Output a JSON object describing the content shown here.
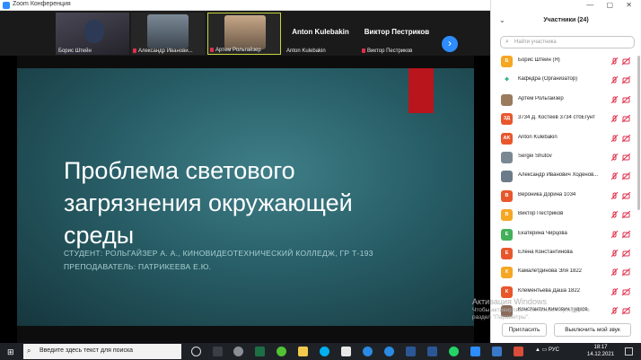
{
  "window_title": "Zoom Конференция",
  "gallery": {
    "tiles": [
      {
        "name": "Борис Штейн",
        "muted": false,
        "kind": "video",
        "color": "#3a3a44"
      },
      {
        "name": "Александр Иванови...",
        "muted": true,
        "kind": "video",
        "color": "#4a5662"
      },
      {
        "name": "Артем Рольгайзер",
        "muted": true,
        "kind": "video",
        "color": "#8a7a68",
        "active": true
      },
      {
        "name": "Anton Kulebakin",
        "muted": false,
        "kind": "name",
        "big": "Anton Kulebakin"
      },
      {
        "name": "Виктор Пестриков",
        "muted": true,
        "kind": "name",
        "big": "Виктор Пестриков"
      }
    ],
    "next_icon": "chevron-right-icon"
  },
  "slide": {
    "title": "Проблема светового загрязнения окружающей среды",
    "subtitle1": "СТУДЕНТ: РОЛЬГАЙЗЕР А. А., КИНОВИДЕОТЕХНИЧЕСКИЙ КОЛЛЕДЖ, ГР Т-193",
    "subtitle2": "ПРЕПОДАВАТЕЛЬ: ПАТРИКЕЕВА Е.Ю.",
    "accent": "#b8151d"
  },
  "participants": {
    "title": "Участники (24)",
    "search_placeholder": "Найти участника",
    "list": [
      {
        "initials": "Б",
        "name": "Борис Штейн (Я)",
        "color": "#f5a623",
        "icons": "🎤🎥"
      },
      {
        "initials": "✤",
        "name": "Кафедра (Организатор)",
        "color": "#ffffff",
        "fg": "#1aa37a",
        "icons": "🎤🎥"
      },
      {
        "initials": "",
        "name": "Артем Рольгайзер",
        "color": "#9a7b5c",
        "icons": "🎤🎥"
      },
      {
        "initials": "ЗД",
        "name": "3734 Д. Костеев 3734 стбЕгунт",
        "color": "#e8572c",
        "icons": "🎤🎥"
      },
      {
        "initials": "AK",
        "name": "Anton Kulebakin",
        "color": "#e8572c",
        "icons": "🎤🎥"
      },
      {
        "initials": "",
        "name": "Sergei Shutov",
        "color": "#7a8894",
        "icons": "🎤🎥"
      },
      {
        "initials": "",
        "name": "Александр Иванович Ходенов...",
        "color": "#6b7b8a",
        "icons": "🎤🎥"
      },
      {
        "initials": "В",
        "name": "Вероника Дорина 1034",
        "color": "#e8572c",
        "icons": "🎤🎥"
      },
      {
        "initials": "В",
        "name": "Виктор Пестриков",
        "color": "#f5a623",
        "icons": "🎤🎥"
      },
      {
        "initials": "Е",
        "name": "Екатерина Чирцова",
        "color": "#43b05c",
        "icons": "🎤🎥"
      },
      {
        "initials": "Е",
        "name": "Елена Константинова",
        "color": "#e8572c",
        "icons": "🎤🎥"
      },
      {
        "initials": "К",
        "name": "Камалетдинова Эля 1822",
        "color": "#f5a623",
        "icons": "🎤🎥"
      },
      {
        "initials": "К",
        "name": "Клементьева Даша 1822",
        "color": "#e8572c",
        "icons": "🎤🎥"
      },
      {
        "initials": "",
        "name": "Константин Кимович Гудков",
        "color": "#8a6a5a",
        "icons": "🎤🎥"
      }
    ],
    "invite_label": "Пригласить",
    "mute_all_label": "Выключить мой звук"
  },
  "watermark": {
    "line1": "Активация Windows",
    "line2": "Чтобы активировать Windows, перейдите в раздел \"Параметры\"."
  },
  "taskbar": {
    "search_placeholder": "Введите здесь текст для поиска",
    "lang": "РУС",
    "time": "18:17",
    "date": "14.12.2021"
  }
}
